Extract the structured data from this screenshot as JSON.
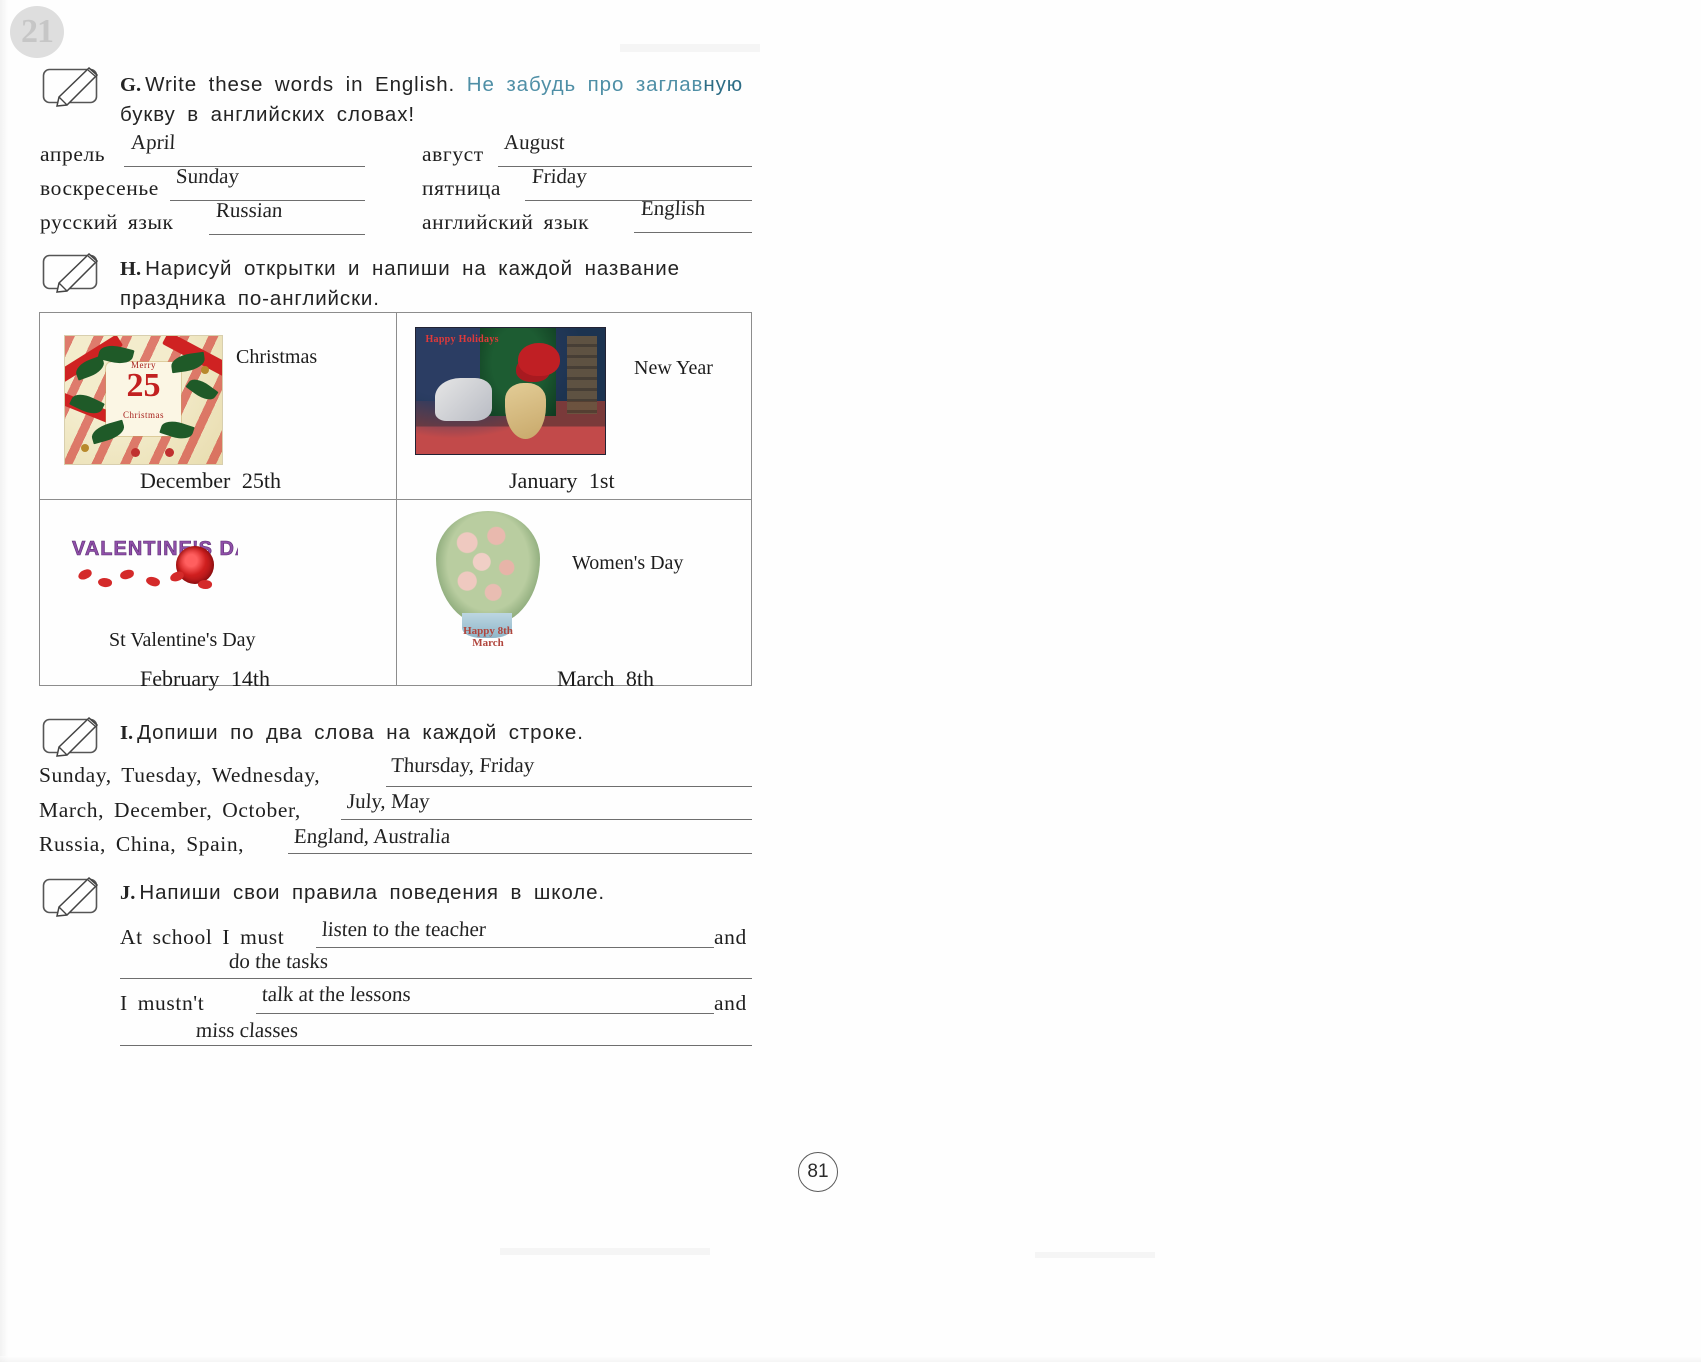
{
  "unit": {
    "number": "21"
  },
  "page": {
    "number": "81"
  },
  "tasks": {
    "g": {
      "letter": "G.",
      "text_en": "Write these words in English.",
      "text_ru_1": "Не забудь про заглав",
      "text_ru_2": "ную",
      "text_ru_line2": "букву в английских словах!",
      "icon": "notepad-pencil-icon",
      "pairs_left": [
        {
          "prompt": "апрель",
          "answer": "April"
        },
        {
          "prompt": "воскресенье",
          "answer": "Sunday"
        },
        {
          "prompt": "русский  язык",
          "answer": "Russian"
        }
      ],
      "pairs_right": [
        {
          "prompt": "август",
          "answer": "August"
        },
        {
          "prompt": "пятница",
          "answer": "Friday"
        },
        {
          "prompt": "английский  язык",
          "answer": "English"
        }
      ]
    },
    "h": {
      "letter": "H.",
      "text_line1": "Нарисуй открытки и напиши на каждой название",
      "text_line2": "праздника по-английски.",
      "icon": "notepad-pencil-icon",
      "cards": [
        {
          "holiday": "Christmas",
          "date": "December  25th",
          "art": "christmas-wreath-card",
          "art_text_number": "25",
          "art_text_top": "Merry",
          "art_text_bottom": "Christmas"
        },
        {
          "holiday": "New Year",
          "date": "January  1st",
          "art": "new-year-tree-photo",
          "art_text_top": "Happy Holidays"
        },
        {
          "holiday": "St Valentine's Day",
          "date": "February  14th",
          "art": "valentine-rose-banner",
          "art_text_top": "VALENTINE'S DAY"
        },
        {
          "holiday": "Women's Day",
          "date": "March  8th",
          "art": "womens-day-bouquet",
          "art_text_bottom_1": "Happy 8th",
          "art_text_bottom_2": "March"
        }
      ]
    },
    "i": {
      "letter": "I.",
      "text": "Допиши по два слова на каждой строке.",
      "icon": "notepad-pencil-icon",
      "rows": [
        {
          "prompt": "Sunday,  Tuesday,  Wednesday,",
          "answer": "Thursday, Friday"
        },
        {
          "prompt": "March,  December,  October,",
          "answer": "July, May"
        },
        {
          "prompt": "Russia,  China,  Spain,",
          "answer": "England, Australia"
        }
      ]
    },
    "j": {
      "letter": "J.",
      "text": "Напиши свои правила поведения в школе.",
      "icon": "notepad-pencil-icon",
      "lines": [
        {
          "lead": "At  school  I  must",
          "answer_1": "listen to the teacher",
          "conj": "and",
          "answer_2": "do the tasks"
        },
        {
          "lead": "I  mustn't",
          "answer_1": "talk at  the lessons",
          "conj": "and",
          "answer_2": "miss classes"
        }
      ]
    }
  },
  "colors": {
    "ru_accent": "#4f8fa6",
    "ink": "#1e1e1e",
    "rule": "#6e6e6e"
  }
}
